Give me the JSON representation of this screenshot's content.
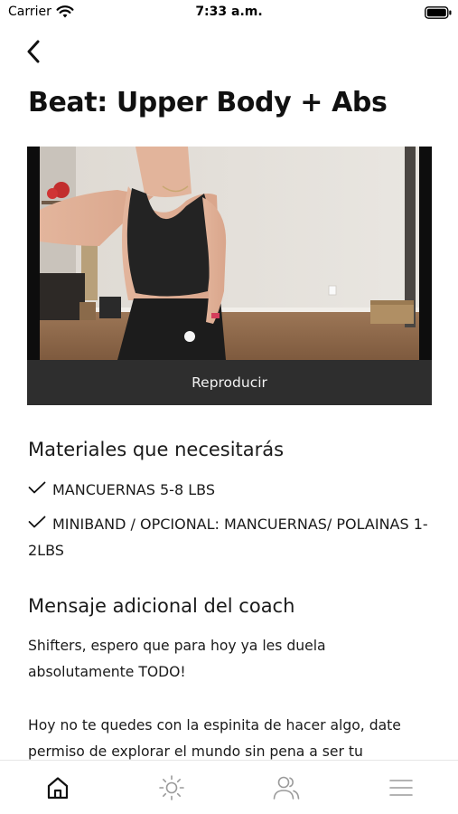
{
  "status_bar": {
    "carrier": "Carrier",
    "time": "7:33 a.m."
  },
  "page": {
    "title": "Beat: Upper Body + Abs"
  },
  "video": {
    "play_label": "Reproducir"
  },
  "materials": {
    "title": "Materiales que necesitarás",
    "items": [
      "MANCUERNAS 5-8 LBS",
      "MINIBAND / OPCIONAL: MANCUERNAS/ POLAINAS 1-2LBS"
    ]
  },
  "coach": {
    "title": "Mensaje adicional del coach",
    "paragraphs": [
      "Shifters, espero que para hoy ya les duela absolutamente TODO!",
      "Hoy no te quedes con la espinita de hacer algo, date permiso de explorar el mundo sin pena a ser tu"
    ]
  },
  "tab_bar": {
    "tabs": [
      {
        "icon": "home-icon",
        "active": true
      },
      {
        "icon": "sun-icon",
        "active": false
      },
      {
        "icon": "users-icon",
        "active": false
      },
      {
        "icon": "menu-icon",
        "active": false
      }
    ]
  },
  "colors": {
    "text": "#111111",
    "play_bar": "#2e2e2e",
    "inactive_icon": "#9a9a9a"
  }
}
